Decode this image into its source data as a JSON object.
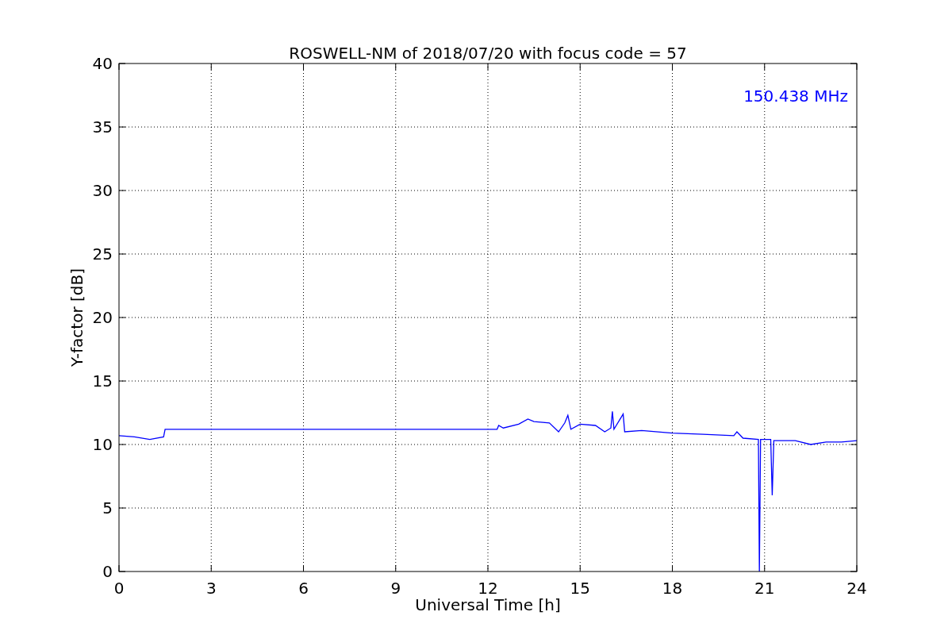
{
  "figure": {
    "chart_data": {
      "type": "line",
      "title": "ROSWELL-NM of 2018/07/20 with focus code = 57",
      "xlabel": "Universal Time [h]",
      "ylabel": "Y-factor [dB]",
      "xlim": [
        0,
        24
      ],
      "ylim": [
        0,
        40
      ],
      "xticks": [
        0,
        3,
        6,
        9,
        12,
        15,
        18,
        21,
        24
      ],
      "yticks": [
        0,
        5,
        10,
        15,
        20,
        25,
        30,
        35,
        40
      ],
      "x": [
        0,
        0.5,
        1.0,
        1.45,
        1.5,
        12.3,
        12.35,
        12.5,
        13.0,
        13.3,
        13.5,
        14.0,
        14.3,
        14.5,
        14.6,
        14.7,
        15.0,
        15.5,
        15.8,
        16.0,
        16.05,
        16.1,
        16.4,
        16.45,
        17.0,
        18.0,
        19.0,
        20.0,
        20.1,
        20.3,
        20.8,
        20.83,
        20.87,
        21.2,
        21.25,
        21.3,
        22.0,
        22.5,
        23.0,
        23.5,
        24.0
      ],
      "series": [
        {
          "color": "#0000ff",
          "values": [
            10.7,
            10.6,
            10.4,
            10.6,
            11.2,
            11.2,
            11.5,
            11.3,
            11.6,
            12.0,
            11.8,
            11.7,
            11.0,
            11.7,
            12.3,
            11.2,
            11.6,
            11.5,
            11.0,
            11.3,
            12.6,
            11.2,
            12.4,
            11.0,
            11.1,
            10.9,
            10.8,
            10.7,
            11.0,
            10.5,
            10.4,
            0,
            10.4,
            10.4,
            6.0,
            10.3,
            10.3,
            10.0,
            10.2,
            10.2,
            10.3
          ]
        }
      ],
      "grid": true,
      "annotations": [
        {
          "text": "150.438 MHz"
        }
      ]
    }
  }
}
